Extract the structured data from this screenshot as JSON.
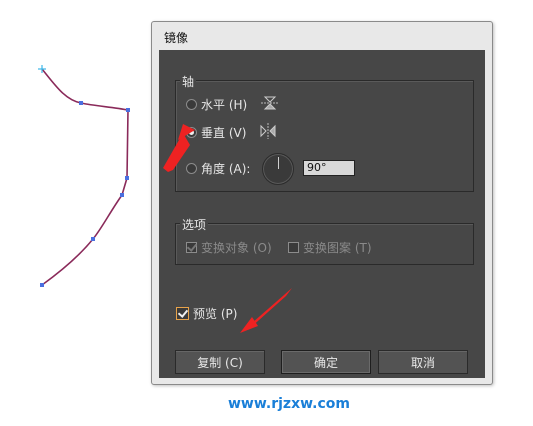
{
  "dialog": {
    "title": "镜像",
    "axis_group": {
      "title": "轴",
      "horizontal_label": "水平 (H)",
      "vertical_label": "垂直 (V)",
      "angle_label": "角度 (A):",
      "angle_value": "90°",
      "selected": "vertical"
    },
    "options_group": {
      "title": "选项",
      "transform_objects_label": "变换对象 (O)",
      "transform_patterns_label": "变换图案 (T)",
      "transform_objects_checked": true,
      "transform_patterns_checked": false
    },
    "preview_label": "预览 (P)",
    "preview_checked": true,
    "buttons": {
      "copy": "复制 (C)",
      "ok": "确定",
      "cancel": "取消"
    }
  },
  "watermark": "www.rjzxw.com",
  "colors": {
    "path_stroke": "#8a2a5a",
    "anchor_points": "#4a6fe0",
    "annotation_arrow": "#ee2222",
    "watermark": "#1a7fd8"
  }
}
